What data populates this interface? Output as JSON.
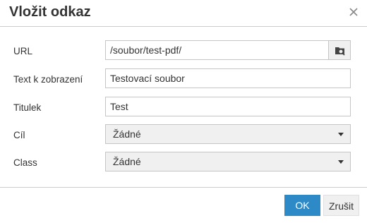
{
  "dialog": {
    "title": "Vložit odkaz",
    "close_icon": "close-icon"
  },
  "form": {
    "url": {
      "label": "URL",
      "value": "/soubor/test-pdf/",
      "browse_icon": "browse-icon"
    },
    "text": {
      "label": "Text k zobrazení",
      "value": "Testovací soubor"
    },
    "title": {
      "label": "Titulek",
      "value": "Test"
    },
    "target": {
      "label": "Cíl",
      "selected": "Žádné"
    },
    "class": {
      "label": "Class",
      "selected": "Žádné"
    }
  },
  "footer": {
    "ok_label": "OK",
    "cancel_label": "Zrušit"
  },
  "colors": {
    "primary": "#2d8ac7",
    "border": "#c5c5c5",
    "button_bg": "#f0f0f0"
  }
}
